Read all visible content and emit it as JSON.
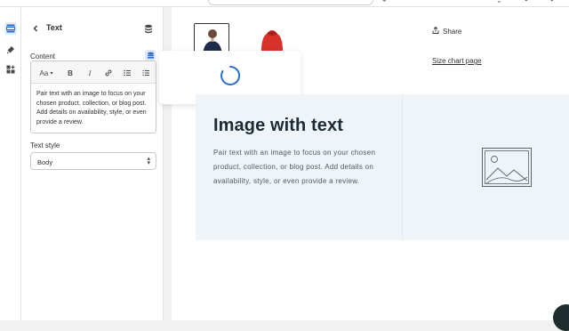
{
  "panel": {
    "title": "Text",
    "content_label": "Content",
    "editor_text": "Pair text with an image to focus on your chosen product, collection, or blog post. Add details on availability, style, or even provide a review.",
    "toolbar": {
      "font_label": "Aa"
    },
    "text_style_label": "Text style",
    "text_style_value": "Body"
  },
  "preview": {
    "share_label": "Share",
    "size_chart_label": "Size chart page",
    "section_heading": "Image with text",
    "section_body": "Pair text with an image to focus on your chosen product, collection, or blog post. Add details on availability, style, or even provide a review."
  },
  "colors": {
    "accent": "#2c6ecb",
    "section_bg": "#eef4f8",
    "loader": "#2c6ecb"
  },
  "icons": [
    "sections-icon",
    "theme-settings-icon",
    "apps-icon",
    "back-arrow-icon",
    "database-stack-icon",
    "dynamic-source-icon",
    "bold-icon",
    "italic-icon",
    "link-icon",
    "bulleted-list-icon",
    "numbered-list-icon",
    "share-icon",
    "image-placeholder-icon",
    "spinner-icon"
  ]
}
